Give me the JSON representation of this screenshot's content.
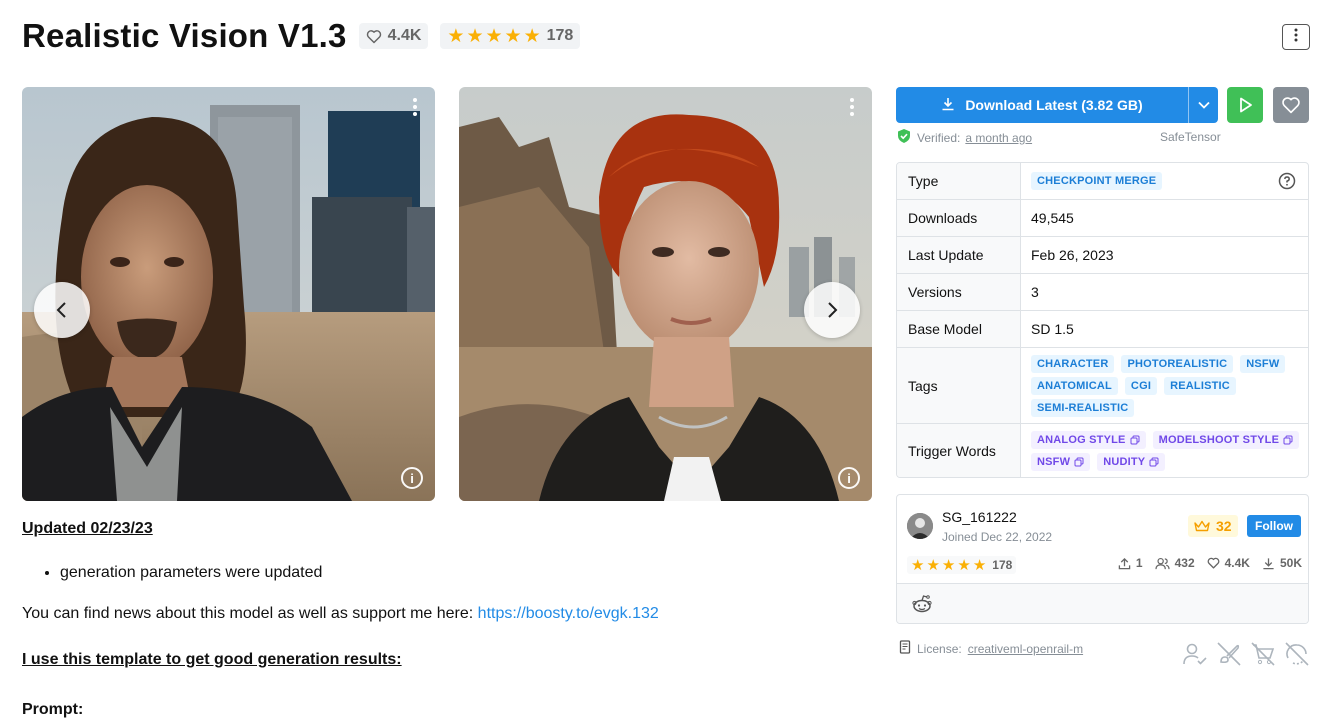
{
  "header": {
    "title": "Realistic Vision V1.3",
    "likes": "4.4K",
    "rating_count": "178",
    "rating_stars": 5
  },
  "gallery": {
    "info_label": "i"
  },
  "description": {
    "updated_heading": "Updated 02/23/23",
    "bullets": [
      "generation parameters were updated"
    ],
    "news_text": "You can find news about this model as well as support me here: ",
    "news_link": "https://boosty.to/evgk.132",
    "template_heading": "I use this template to get good generation results:",
    "prompt_label": "Prompt:"
  },
  "download": {
    "label": "Download Latest (3.82 GB)",
    "verified_label": "Verified:",
    "verified_time": "a month ago",
    "format": "SafeTensor"
  },
  "details": {
    "type_label": "Type",
    "type_value": "CHECKPOINT MERGE",
    "downloads_label": "Downloads",
    "downloads_value": "49,545",
    "last_update_label": "Last Update",
    "last_update_value": "Feb 26, 2023",
    "versions_label": "Versions",
    "versions_value": "3",
    "base_model_label": "Base Model",
    "base_model_value": "SD 1.5",
    "tags_label": "Tags",
    "tags": [
      "CHARACTER",
      "PHOTOREALISTIC",
      "NSFW",
      "ANATOMICAL",
      "CGI",
      "REALISTIC",
      "SEMI-REALISTIC"
    ],
    "trigger_label": "Trigger Words",
    "trigger_words": [
      "ANALOG STYLE",
      "MODELSHOOT STYLE",
      "NSFW",
      "NUDITY"
    ]
  },
  "creator": {
    "name": "SG_161222",
    "joined": "Joined Dec 22, 2022",
    "rank": "32",
    "follow_label": "Follow",
    "rating_count": "178",
    "uploads": "1",
    "followers": "432",
    "likes": "4.4K",
    "downloads": "50K"
  },
  "license": {
    "label": "License:",
    "name": "creativeml-openrail-m"
  },
  "colors": {
    "primary": "#228be6",
    "success": "#40c057",
    "gray": "#868e96",
    "star": "#fab005"
  }
}
